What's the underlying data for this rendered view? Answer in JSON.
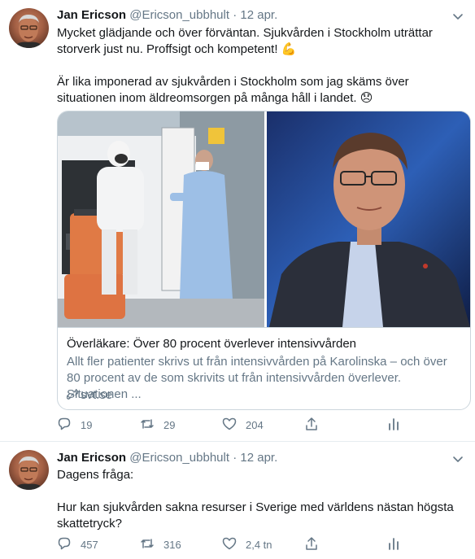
{
  "tweets": [
    {
      "author_name": "Jan Ericson",
      "handle": "@Ericson_ubbhult",
      "separator": "·",
      "date": "12 apr.",
      "paragraphs": [
        "Mycket glädjande och över förväntan. Sjukvården i Stockholm uträttar storverk just nu. Proffsigt och kompetent!",
        "Är lika imponerad av sjukvården i Stockholm som jag skäms över situationen inom äldreomsorgen på många håll i landet."
      ],
      "emojis": [
        "💪",
        "😞"
      ],
      "card": {
        "title": "Överläkare: Över 80 procent överlever intensivvården",
        "description": "Allt fler patienter skrivs ut från intensivvården på Karolinska – och över 80 procent av de som skrivits ut från intensivvården överlever. Situationen ...",
        "domain": "svt.se"
      },
      "actions": {
        "replies": "19",
        "retweets": "29",
        "likes": "204"
      }
    },
    {
      "author_name": "Jan Ericson",
      "handle": "@Ericson_ubbhult",
      "separator": "·",
      "date": "12 apr.",
      "paragraphs": [
        "Dagens fråga:",
        "Hur kan sjukvården sakna resurser i Sverige med världens nästan högsta skattetryck?"
      ],
      "actions": {
        "replies": "457",
        "retweets": "316",
        "likes": "2,4 tn"
      }
    }
  ],
  "icons": [
    "avatar",
    "chevron-down-icon",
    "reply-icon",
    "retweet-icon",
    "like-icon",
    "share-icon",
    "analytics-icon",
    "link-icon"
  ],
  "colors": {
    "text": "#14171a",
    "secondary": "#657786",
    "border": "#ccd6dd",
    "divider": "#e6ecf0"
  }
}
